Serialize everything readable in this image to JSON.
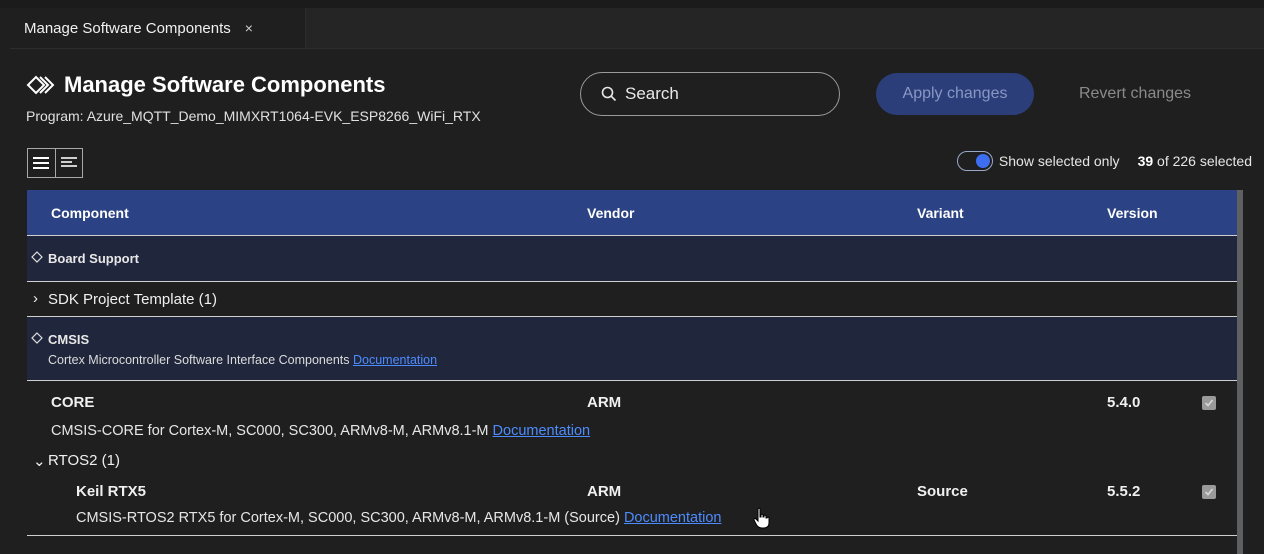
{
  "tab": {
    "label": "Manage Software Components",
    "close": "×"
  },
  "header": {
    "title": "Manage Software Components",
    "program": "Program: Azure_MQTT_Demo_MIMXRT1064-EVK_ESP8266_WiFi_RTX",
    "search_label": "Search",
    "apply_label": "Apply changes",
    "revert_label": "Revert changes"
  },
  "toolbar": {
    "show_selected_label": "Show selected only",
    "show_selected_on": true,
    "selected_count": "39",
    "selected_suffix": "of 226 selected"
  },
  "columns": {
    "component": "Component",
    "vendor": "Vendor",
    "variant": "Variant",
    "version": "Version"
  },
  "rows": {
    "board_support": {
      "label": "Board Support"
    },
    "sdk_template": {
      "label": "SDK Project Template (1)"
    },
    "cmsis": {
      "label": "CMSIS",
      "description": "Cortex Microcontroller Software Interface Components",
      "link": "Documentation"
    },
    "core": {
      "name": "CORE",
      "vendor": "ARM",
      "variant": "",
      "version": "5.4.0",
      "description": "CMSIS-CORE for Cortex-M, SC000, SC300, ARMv8-M, ARMv8.1-M",
      "link": "Documentation",
      "checked": true
    },
    "rtos2": {
      "label": "RTOS2 (1)"
    },
    "keil_rtx5": {
      "name": "Keil RTX5",
      "vendor": "ARM",
      "variant": "Source",
      "version": "5.5.2",
      "description": "CMSIS-RTOS2 RTX5 for Cortex-M, SC000, SC300, ARMv8-M, ARMv8.1-M (Source)",
      "link": "Documentation",
      "checked": true
    }
  },
  "colors": {
    "accent": "#2b4284",
    "link": "#4d8cff",
    "toggle": "#3d6df0",
    "apply_bg": "#2b3e7a"
  },
  "icons": [
    "close-icon",
    "components-icon",
    "search-icon",
    "list-view-icon",
    "compact-view-icon",
    "diamond-icon",
    "chevron-right-icon",
    "chevron-down-icon",
    "checkbox-icon",
    "hand-cursor-icon"
  ]
}
